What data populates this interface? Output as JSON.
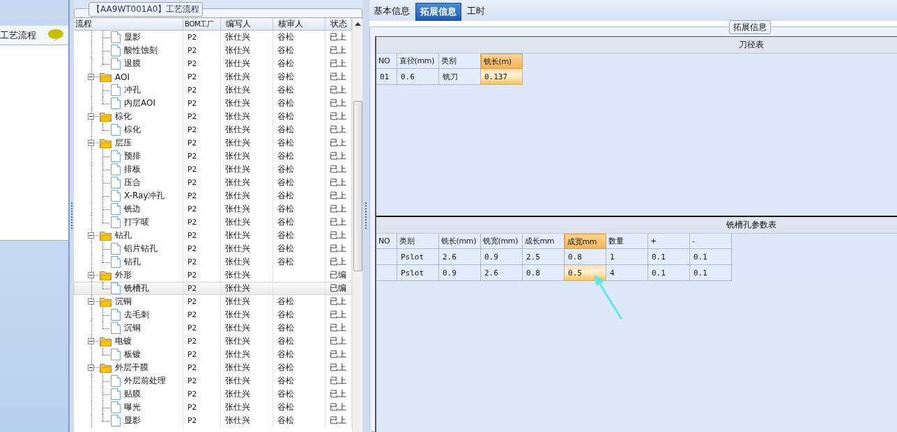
{
  "sidebar": {
    "title": "工艺流程"
  },
  "process_panel": {
    "title": "【AA9WT001A0】工艺流程",
    "columns": [
      "流程",
      "BOM工厂",
      "编写人",
      "核审人",
      "状态"
    ],
    "rows": [
      {
        "children": [
          {
            "kind": "step",
            "label": "显影",
            "bom": "P2",
            "author": "张仕兴",
            "reviewer": "谷松",
            "status": "已上",
            "selected": false
          },
          {
            "kind": "step",
            "label": "酸性蚀刻",
            "bom": "P2",
            "author": "张仕兴",
            "reviewer": "谷松",
            "status": "已上",
            "selected": false
          },
          {
            "kind": "step",
            "label": "退膜",
            "bom": "P2",
            "author": "张仕兴",
            "reviewer": "谷松",
            "status": "已上",
            "selected": false
          }
        ]
      },
      {
        "kind": "folder",
        "label": "AOI",
        "bom": "P2",
        "author": "张仕兴",
        "reviewer": "谷松",
        "status": "已上",
        "selected": false,
        "expanded": true,
        "children": [
          {
            "kind": "step",
            "label": "冲孔",
            "bom": "P2",
            "author": "张仕兴",
            "reviewer": "谷松",
            "status": "已上",
            "selected": false
          },
          {
            "kind": "step",
            "label": "内层AOI",
            "bom": "P2",
            "author": "张仕兴",
            "reviewer": "谷松",
            "status": "已上",
            "selected": false
          }
        ]
      },
      {
        "kind": "folder",
        "label": "棕化",
        "bom": "P2",
        "author": "张仕兴",
        "reviewer": "谷松",
        "status": "已上",
        "selected": false,
        "expanded": true,
        "children": [
          {
            "kind": "step",
            "label": "棕化",
            "bom": "P2",
            "author": "张仕兴",
            "reviewer": "谷松",
            "status": "已上",
            "selected": false
          }
        ]
      },
      {
        "kind": "folder",
        "label": "层压",
        "bom": "P2",
        "author": "张仕兴",
        "reviewer": "谷松",
        "status": "已上",
        "selected": false,
        "expanded": true,
        "children": [
          {
            "kind": "step",
            "label": "预排",
            "bom": "P2",
            "author": "张仕兴",
            "reviewer": "谷松",
            "status": "已上",
            "selected": false
          },
          {
            "kind": "step",
            "label": "排板",
            "bom": "P2",
            "author": "张仕兴",
            "reviewer": "谷松",
            "status": "已上",
            "selected": false
          },
          {
            "kind": "step",
            "label": "压合",
            "bom": "P2",
            "author": "张仕兴",
            "reviewer": "谷松",
            "status": "已上",
            "selected": false
          },
          {
            "kind": "step",
            "label": "X-Ray冲孔",
            "bom": "P2",
            "author": "张仕兴",
            "reviewer": "谷松",
            "status": "已上",
            "selected": false
          },
          {
            "kind": "step",
            "label": "铣边",
            "bom": "P2",
            "author": "张仕兴",
            "reviewer": "谷松",
            "status": "已上",
            "selected": false
          },
          {
            "kind": "step",
            "label": "打字唛",
            "bom": "P2",
            "author": "张仕兴",
            "reviewer": "谷松",
            "status": "已上",
            "selected": false
          }
        ]
      },
      {
        "kind": "folder",
        "label": "钻孔",
        "bom": "P2",
        "author": "张仕兴",
        "reviewer": "谷松",
        "status": "已上",
        "selected": false,
        "expanded": true,
        "children": [
          {
            "kind": "step",
            "label": "铝片钻孔",
            "bom": "P2",
            "author": "张仕兴",
            "reviewer": "谷松",
            "status": "已上",
            "selected": false
          },
          {
            "kind": "step",
            "label": "钻孔",
            "bom": "P2",
            "author": "张仕兴",
            "reviewer": "谷松",
            "status": "已上",
            "selected": false
          }
        ]
      },
      {
        "kind": "folder",
        "label": "外形",
        "bom": "P2",
        "author": "张仕兴",
        "status": "已编",
        "selected": false,
        "expanded": true,
        "children": [
          {
            "kind": "step",
            "label": "铣槽孔",
            "bom": "P2",
            "author": "张仕兴",
            "status": "已编",
            "selected": true
          }
        ]
      },
      {
        "kind": "folder",
        "label": "沉铜",
        "bom": "P2",
        "author": "张仕兴",
        "reviewer": "谷松",
        "status": "已上",
        "selected": false,
        "expanded": true,
        "children": [
          {
            "kind": "step",
            "label": "去毛刺",
            "bom": "P2",
            "author": "张仕兴",
            "reviewer": "谷松",
            "status": "已上",
            "selected": false
          },
          {
            "kind": "step",
            "label": "沉铜",
            "bom": "P2",
            "author": "张仕兴",
            "reviewer": "谷松",
            "status": "已上",
            "selected": false
          }
        ]
      },
      {
        "kind": "folder",
        "label": "电镀",
        "bom": "P2",
        "author": "张仕兴",
        "reviewer": "谷松",
        "status": "已上",
        "selected": false,
        "expanded": true,
        "children": [
          {
            "kind": "step",
            "label": "板镀",
            "bom": "P2",
            "author": "张仕兴",
            "reviewer": "谷松",
            "status": "已上",
            "selected": false
          }
        ]
      },
      {
        "kind": "folder",
        "label": "外层干膜",
        "bom": "P2",
        "author": "张仕兴",
        "reviewer": "谷松",
        "status": "已上",
        "selected": false,
        "expanded": true,
        "children": [
          {
            "kind": "step",
            "label": "外层前处理",
            "bom": "P2",
            "author": "张仕兴",
            "reviewer": "谷松",
            "status": "已上",
            "selected": false
          },
          {
            "kind": "step",
            "label": "贴膜",
            "bom": "P2",
            "author": "张仕兴",
            "reviewer": "谷松",
            "status": "已上",
            "selected": false
          },
          {
            "kind": "step",
            "label": "曝光",
            "bom": "P2",
            "author": "张仕兴",
            "reviewer": "谷松",
            "status": "已上",
            "selected": false
          },
          {
            "kind": "step",
            "label": "显影",
            "bom": "P2",
            "author": "张仕兴",
            "reviewer": "谷松",
            "status": "已上",
            "selected": false
          }
        ]
      }
    ]
  },
  "tabs": [
    {
      "label": "基本信息",
      "selected": false
    },
    {
      "label": "拓展信息",
      "selected": true
    },
    {
      "label": "工时",
      "selected": false
    }
  ],
  "extended_info": {
    "title": "拓展信息",
    "tables": [
      {
        "title": "刀径表",
        "columns": [
          {
            "label": "NO",
            "selected": false
          },
          {
            "label": "直径(mm)",
            "selected": false
          },
          {
            "label": "类别",
            "selected": false
          },
          {
            "label": "铣长(m)",
            "selected": true
          }
        ],
        "rows": [
          {
            "cells": [
              {
                "text": "01",
                "selected": false
              },
              {
                "text": "0.6",
                "selected": false
              },
              {
                "text": "铣刀",
                "selected": false
              },
              {
                "text": "0.137",
                "selected": true
              }
            ]
          }
        ]
      },
      {
        "title": "铣槽孔参数表",
        "columns": [
          {
            "label": "NO",
            "selected": false
          },
          {
            "label": "类别",
            "selected": false
          },
          {
            "label": "铣长(mm)",
            "selected": false
          },
          {
            "label": "铣宽(mm)",
            "selected": false
          },
          {
            "label": "成长mm",
            "selected": false
          },
          {
            "label": "成宽mm",
            "selected": true
          },
          {
            "label": "数量",
            "selected": false
          },
          {
            "label": "+",
            "selected": false
          },
          {
            "label": "-",
            "selected": false
          }
        ],
        "rows": [
          {
            "cells": [
              {
                "text": "",
                "selected": false
              },
              {
                "text": "Pslot",
                "selected": false
              },
              {
                "text": "2.6",
                "selected": false
              },
              {
                "text": "0.9",
                "selected": false
              },
              {
                "text": "2.5",
                "selected": false
              },
              {
                "text": "0.8",
                "selected": false
              },
              {
                "text": "1",
                "selected": false
              },
              {
                "text": "0.1",
                "selected": false
              },
              {
                "text": "0.1",
                "selected": false
              }
            ]
          },
          {
            "cells": [
              {
                "text": "",
                "selected": false
              },
              {
                "text": "Pslot",
                "selected": false
              },
              {
                "text": "0.9",
                "selected": false
              },
              {
                "text": "2.6",
                "selected": false
              },
              {
                "text": "0.8",
                "selected": false
              },
              {
                "text": "0.5",
                "selected": true
              },
              {
                "text": "4",
                "selected": false
              },
              {
                "text": "0.1",
                "selected": false
              },
              {
                "text": "0.1",
                "selected": false
              }
            ]
          }
        ]
      }
    ]
  }
}
